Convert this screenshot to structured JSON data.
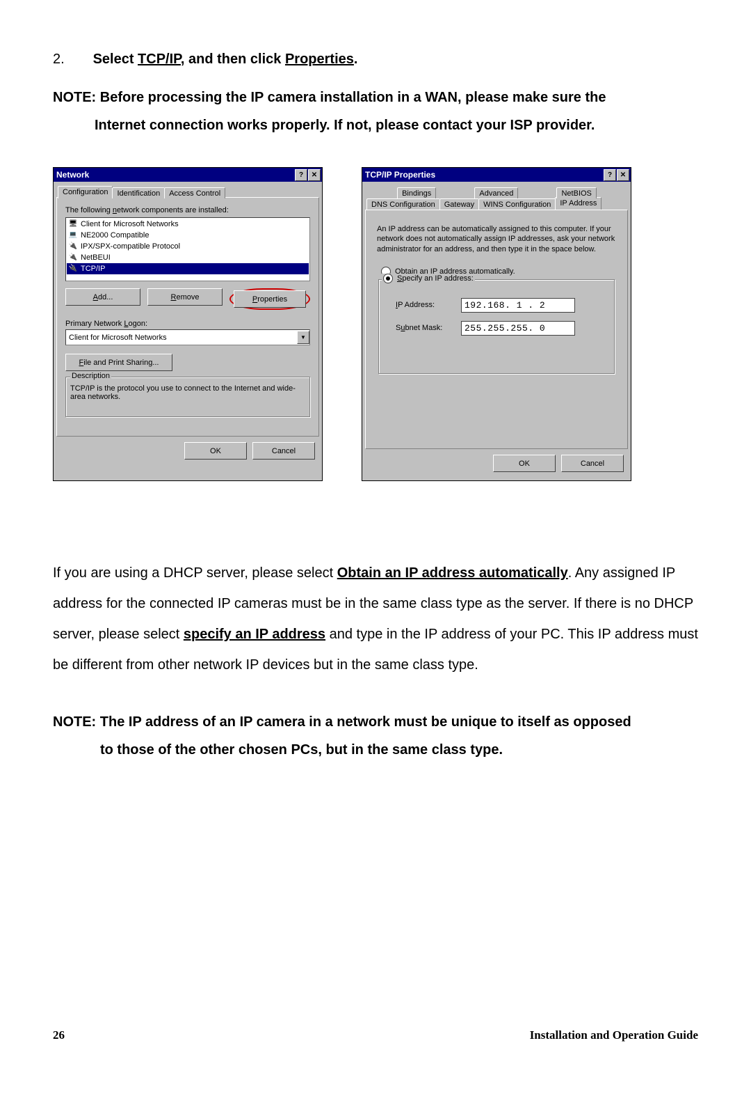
{
  "instruction": {
    "number": "2.",
    "pre": "Select ",
    "link1": "TCP/IP",
    "mid": ", and then click ",
    "link2": "Properties",
    "post": "."
  },
  "note1": {
    "line1": "NOTE: Before processing the IP camera installation in a WAN, please make sure the",
    "line2": "Internet connection works properly. If not, please contact your ISP provider."
  },
  "network_dialog": {
    "title": "Network",
    "help_glyph": "?",
    "close_glyph": "✕",
    "tabs": [
      "Configuration",
      "Identification",
      "Access Control"
    ],
    "list_label_pre": "The following ",
    "list_label_accel": "n",
    "list_label_post": "etwork components are installed:",
    "items": [
      "Client for Microsoft Networks",
      "NE2000 Compatible",
      "IPX/SPX-compatible Protocol",
      "NetBEUI",
      "TCP/IP"
    ],
    "buttons": {
      "add_accel": "A",
      "add_rest": "dd...",
      "remove_accel": "R",
      "remove_rest": "emove",
      "properties_accel": "P",
      "properties_rest": "roperties"
    },
    "primary_label_pre": "Primary Network ",
    "primary_label_accel": "L",
    "primary_label_post": "ogon:",
    "primary_value": "Client for Microsoft Networks",
    "file_print_accel": "F",
    "file_print_rest": "ile and Print Sharing...",
    "desc_legend": "Description",
    "desc_text": "TCP/IP is the protocol you use to connect to the Internet and wide-area networks.",
    "ok": "OK",
    "cancel": "Cancel",
    "dd_arrow": "▼"
  },
  "tcpip_dialog": {
    "title": "TCP/IP Properties",
    "help_glyph": "?",
    "close_glyph": "✕",
    "tab_row1": [
      "Bindings",
      "Advanced",
      "NetBIOS"
    ],
    "tab_row2": [
      "DNS Configuration",
      "Gateway",
      "WINS Configuration",
      "IP Address"
    ],
    "explain": "An IP address can be automatically assigned to this computer. If your network does not automatically assign IP addresses, ask your network administrator for an address, and then type it in the space below.",
    "radio_auto_accel": "O",
    "radio_auto_rest": "btain an IP address automatically.",
    "radio_spec_accel": "S",
    "radio_spec_rest": "pecify an IP address:",
    "ip_label_accel": "I",
    "ip_label_rest": "P Address:",
    "ip_value": "192.168. 1 . 2",
    "mask_label_pre": "S",
    "mask_label_accel": "u",
    "mask_label_post": "bnet Mask:",
    "mask_value": "255.255.255. 0",
    "ok": "OK",
    "cancel": "Cancel"
  },
  "bodytext": {
    "p1a": "If you are using a DHCP server, please select ",
    "p1b": "Obtain an IP address automatically",
    "p1c": ". Any assigned IP address for the connected IP cameras must be in the same class type as the server. If there is no DHCP server, please select ",
    "p1d": "specify an IP address",
    "p1e": " and type in the IP address of your PC. This IP address must be different from other network IP devices but in the same class type."
  },
  "note2": {
    "line1": "NOTE: The IP address of an IP camera in a network must be unique to itself as opposed",
    "line2": "to those of the other chosen PCs, but in the same class type."
  },
  "footer": {
    "page": "26",
    "guide": "Installation and Operation Guide"
  }
}
